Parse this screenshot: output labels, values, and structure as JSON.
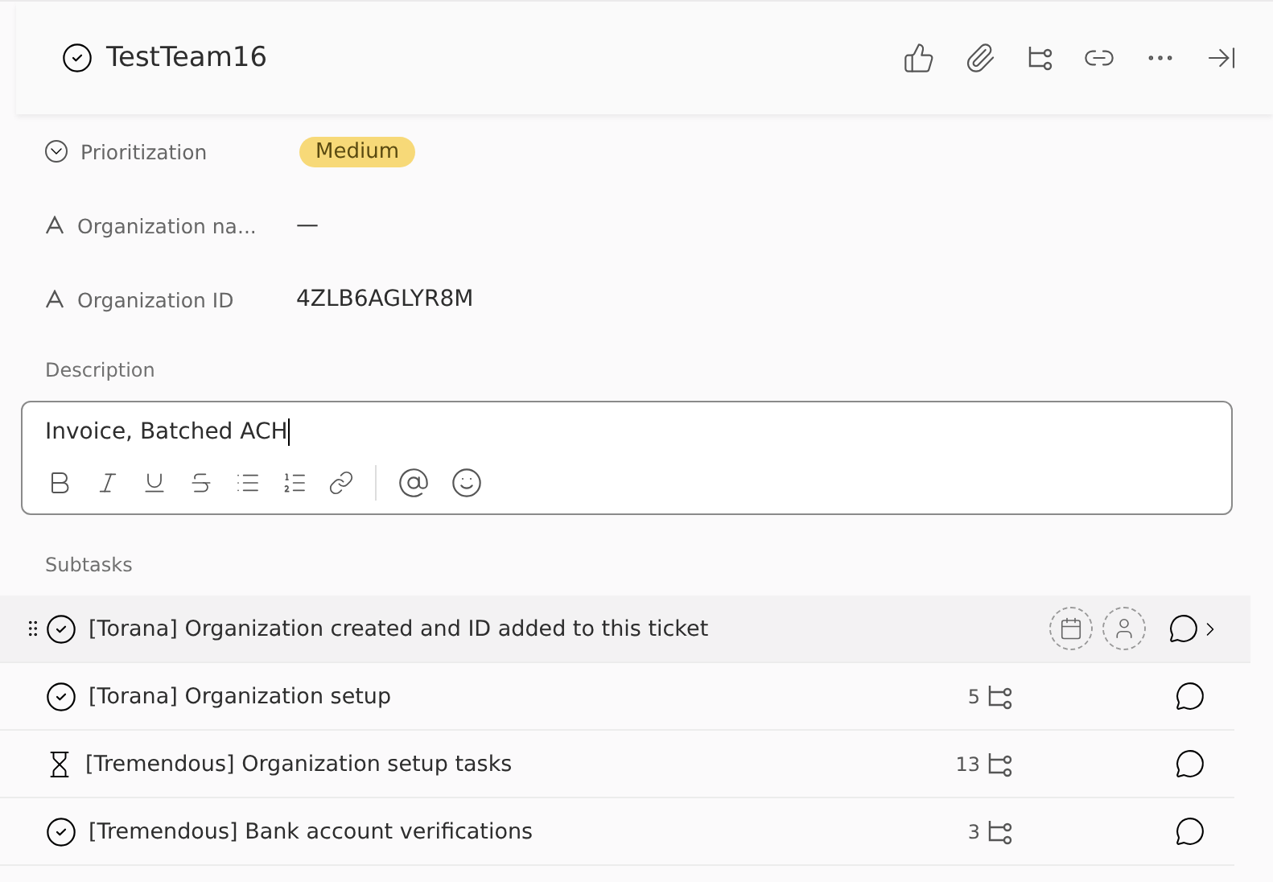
{
  "header": {
    "title": "TestTeam16"
  },
  "fields": [
    {
      "kind": "choice",
      "label": "Prioritization",
      "value": "Medium"
    },
    {
      "kind": "text",
      "label": "Organization na...",
      "value": "—"
    },
    {
      "kind": "text",
      "label": "Organization ID",
      "value": "4ZLB6AGLYR8M"
    }
  ],
  "description": {
    "label": "Description",
    "value": "Invoice, Batched ACH"
  },
  "subtasks": {
    "label": "Subtasks",
    "items": [
      {
        "kind": "done",
        "title": "[Torana] Organization created and ID added to this ticket",
        "hovered": true
      },
      {
        "kind": "done",
        "title": "[Torana] Organization setup",
        "count": "5",
        "hovered": false
      },
      {
        "kind": "waiting",
        "title": "[Tremendous] Organization setup tasks",
        "count": "13",
        "hovered": false
      },
      {
        "kind": "done",
        "title": "[Tremendous] Bank account verifications",
        "count": "3",
        "hovered": false
      }
    ]
  }
}
